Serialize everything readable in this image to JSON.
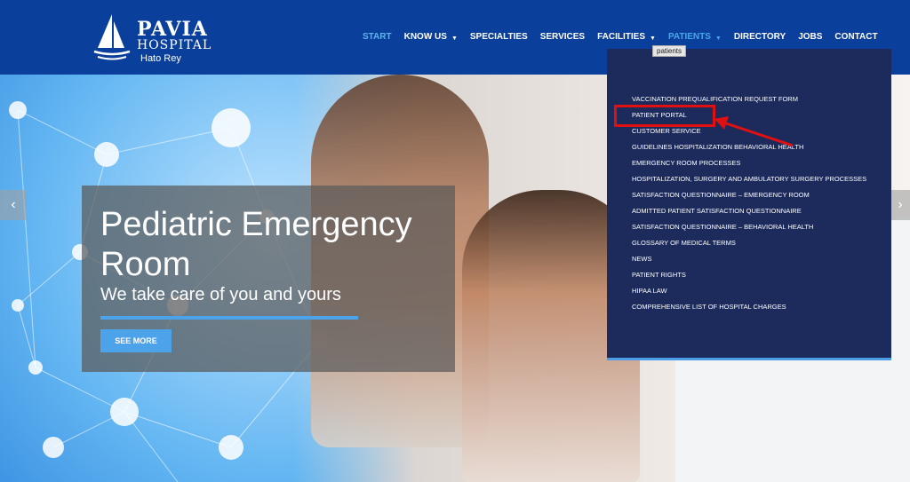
{
  "brand": {
    "name": "PAVIA",
    "subname": "HOSPITAL",
    "location": "Hato Rey"
  },
  "nav": [
    {
      "label": "START",
      "state": "active"
    },
    {
      "label": "KNOW US",
      "caret": "▼"
    },
    {
      "label": "SPECIALTIES"
    },
    {
      "label": "SERVICES"
    },
    {
      "label": "FACILITIES",
      "caret": "▼"
    },
    {
      "label": "PATIENTS",
      "caret": "▼",
      "state": "open"
    },
    {
      "label": "DIRECTORY"
    },
    {
      "label": "JOBS"
    },
    {
      "label": "CONTACT"
    }
  ],
  "tooltip": "patients",
  "hero": {
    "title": "Pediatric Emergency Room",
    "subtitle": "We take care of you and yours",
    "button": "SEE MORE",
    "prev_arrow": "‹",
    "next_arrow": "›"
  },
  "patients_menu": [
    "VACCINATION PREQUALIFICATION REQUEST FORM",
    "PATIENT PORTAL",
    "CUSTOMER SERVICE",
    "GUIDELINES HOSPITALIZATION BEHAVIORAL HEALTH",
    "EMERGENCY ROOM PROCESSES",
    "HOSPITALIZATION, SURGERY AND AMBULATORY SURGERY PROCESSES",
    "SATISFACTION QUESTIONNAIRE – EMERGENCY ROOM",
    "ADMITTED PATIENT SATISFACTION QUESTIONNAIRE",
    "SATISFACTION QUESTIONNAIRE – BEHAVIORAL HEALTH",
    "GLOSSARY OF MEDICAL TERMS",
    "NEWS",
    "PATIENT RIGHTS",
    "HIPAA LAW",
    "COMPREHENSIVE LIST OF HOSPITAL CHARGES"
  ],
  "colors": {
    "header": "#0a3f9c",
    "accent": "#4da3ea",
    "dropdown": "#1c2b5c",
    "highlight": "#e01010"
  }
}
